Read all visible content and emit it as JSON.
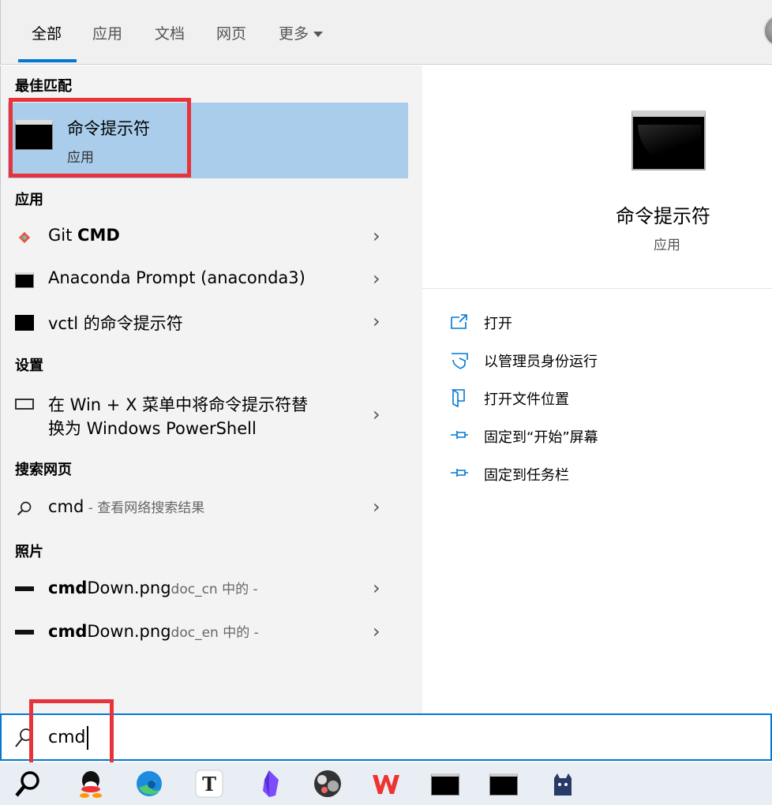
{
  "tabs": [
    "全部",
    "应用",
    "文档",
    "网页",
    "更多"
  ],
  "sections": {
    "best_match": "最佳匹配",
    "apps": "应用",
    "settings": "设置",
    "web": "搜索网页",
    "photos": "照片"
  },
  "best_match": {
    "title": "命令提示符",
    "subtitle": "应用"
  },
  "apps": [
    {
      "name_plain": "Git ",
      "name_bold": "CMD",
      "icon": "git-icon"
    },
    {
      "name_plain": "Anaconda Prompt (anaconda3)",
      "icon": "terminal-icon"
    },
    {
      "name_plain": "vctl 的命令提示符",
      "icon": "terminal-icon"
    }
  ],
  "settings_item": {
    "line1": "在 Win + X 菜单中将命令提示符替",
    "line2": "换为 Windows PowerShell",
    "icon": "monitor-icon"
  },
  "web_item": {
    "query": "cmd",
    "hint": " - 查看网络搜索结果",
    "icon": "search-icon"
  },
  "photos": [
    {
      "bold": "cmd",
      "name": "Down.png",
      "location": "doc_cn 中的 -"
    },
    {
      "bold": "cmd",
      "name": "Down.png",
      "location": "doc_en 中的 -"
    }
  ],
  "preview": {
    "title": "命令提示符",
    "subtitle": "应用"
  },
  "actions": [
    {
      "label": "打开",
      "icon": "open-icon"
    },
    {
      "label": "以管理员身份运行",
      "icon": "shield-icon"
    },
    {
      "label": "打开文件位置",
      "icon": "folder-icon"
    },
    {
      "label": "固定到“开始”屏幕",
      "icon": "pin-icon"
    },
    {
      "label": "固定到任务栏",
      "icon": "pin-icon"
    }
  ],
  "search": {
    "value": "cmd"
  },
  "colors": {
    "accent": "#0078d4",
    "highlight": "#aacdeb",
    "annotation": "#e8333b"
  }
}
